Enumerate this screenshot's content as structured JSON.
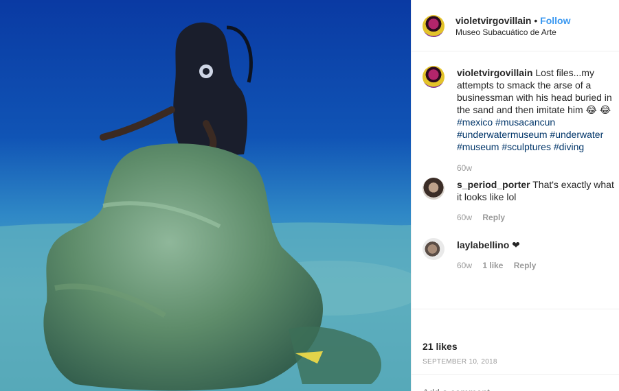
{
  "post": {
    "username": "violetvirgovillain",
    "separator": "•",
    "follow_label": "Follow",
    "location": "Museo Subacuático de Arte"
  },
  "caption": {
    "username": "violetvirgovillain",
    "text": "Lost files...my attempts to smack the arse of a businessman with his head buried in the sand and then imitate him 😂 😂",
    "hashtags": [
      "#mexico",
      "#musacancun",
      "#underwatermuseum",
      "#underwater",
      "#museum",
      "#sculptures",
      "#diving"
    ],
    "age": "60w"
  },
  "comments": [
    {
      "username": "s_period_porter",
      "text": "That's exactly what it looks like lol",
      "age": "60w",
      "likes": "",
      "reply_label": "Reply"
    },
    {
      "username": "laylabellino",
      "text": "❤",
      "age": "60w",
      "likes": "1 like",
      "reply_label": "Reply"
    }
  ],
  "stats": {
    "likes": "21 likes",
    "date": "SEPTEMBER 10, 2018"
  },
  "add_comment": {
    "placeholder": "Add a comment..."
  },
  "icons": {
    "avatar": "avatar-icon",
    "heart": "heart-icon"
  },
  "colors": {
    "link_blue": "#3897f0",
    "hashtag": "#003569",
    "muted": "#999999",
    "water": "#0f56b6"
  }
}
